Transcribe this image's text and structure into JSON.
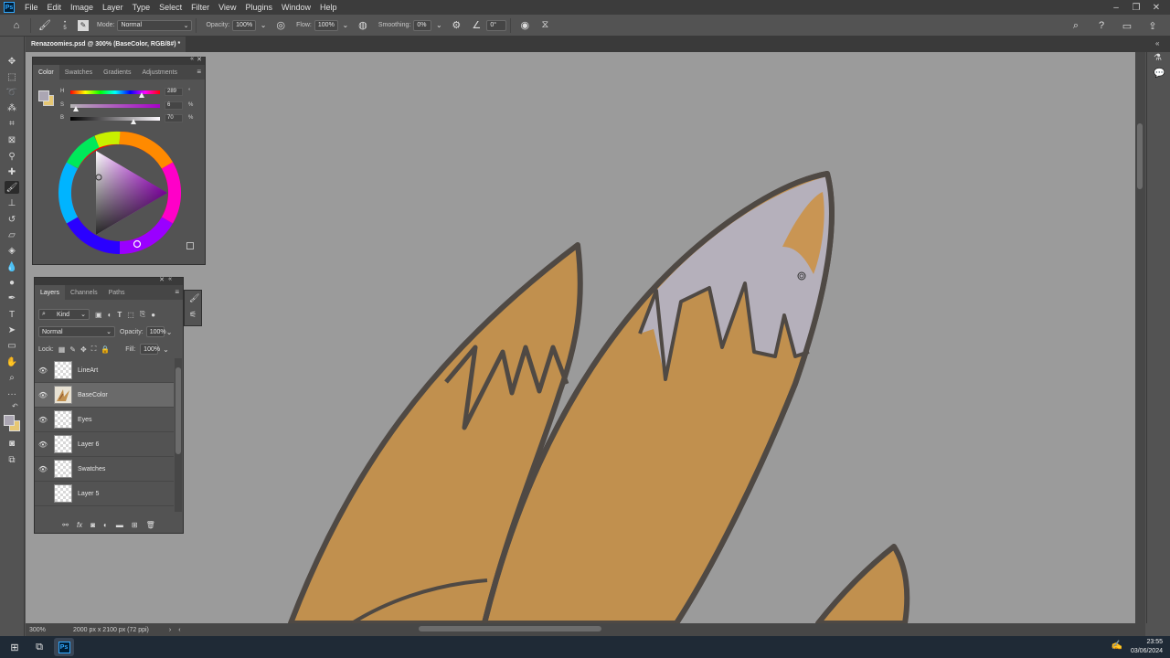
{
  "app": {
    "menu": [
      "File",
      "Edit",
      "Image",
      "Layer",
      "Type",
      "Select",
      "Filter",
      "View",
      "Plugins",
      "Window",
      "Help"
    ],
    "logo_text": "Ps"
  },
  "options_bar": {
    "mode_label": "Mode:",
    "mode_value": "Normal",
    "opacity_label": "Opacity:",
    "opacity_value": "100%",
    "flow_label": "Flow:",
    "flow_value": "100%",
    "smoothing_label": "Smoothing:",
    "smoothing_value": "0%",
    "angle_value": "0°",
    "brush_size": "5"
  },
  "document": {
    "tab_title": "Renazoomies.psd @ 300% (BaseColor, RGB/8#) *"
  },
  "status": {
    "zoom": "300%",
    "doc_size": "2000 px x 2100 px (72 ppi)"
  },
  "color_panel": {
    "tabs": [
      "Color",
      "Swatches",
      "Gradients",
      "Adjustments"
    ],
    "active_tab": "Color",
    "h_label": "H",
    "h_value": "289",
    "h_unit": "°",
    "h_fraction": 0.8,
    "s_label": "S",
    "s_value": "6",
    "s_unit": "%",
    "s_fraction": 0.06,
    "b_label": "B",
    "b_value": "70",
    "b_unit": "%",
    "b_fraction": 0.7,
    "foreground_color": "#aba6b3",
    "background_color": "#e6c773"
  },
  "layers_panel": {
    "tabs": [
      "Layers",
      "Channels",
      "Paths"
    ],
    "active_tab": "Layers",
    "filter_label": "Kind",
    "blend_mode": "Normal",
    "opacity_label": "Opacity:",
    "opacity_value": "100%",
    "lock_label": "Lock:",
    "fill_label": "Fill:",
    "fill_value": "100%",
    "layers": [
      {
        "name": "LineArt",
        "visible": true,
        "selected": false
      },
      {
        "name": "BaseColor",
        "visible": true,
        "selected": true
      },
      {
        "name": "Eyes",
        "visible": true,
        "selected": false
      },
      {
        "name": "Layer 6",
        "visible": true,
        "selected": false
      },
      {
        "name": "Swatches",
        "visible": true,
        "selected": false
      },
      {
        "name": "Layer 5",
        "visible": false,
        "selected": false
      }
    ]
  },
  "taskbar": {
    "time": "23:55",
    "date": "03/06/2024"
  },
  "colors": {
    "canvas_bg": "#9b9b9b",
    "fur_orange": "#c1904e",
    "tip_lavender": "#b5b0bb",
    "line_art": "#4f4944",
    "accent_blue": "#31a8ff"
  }
}
